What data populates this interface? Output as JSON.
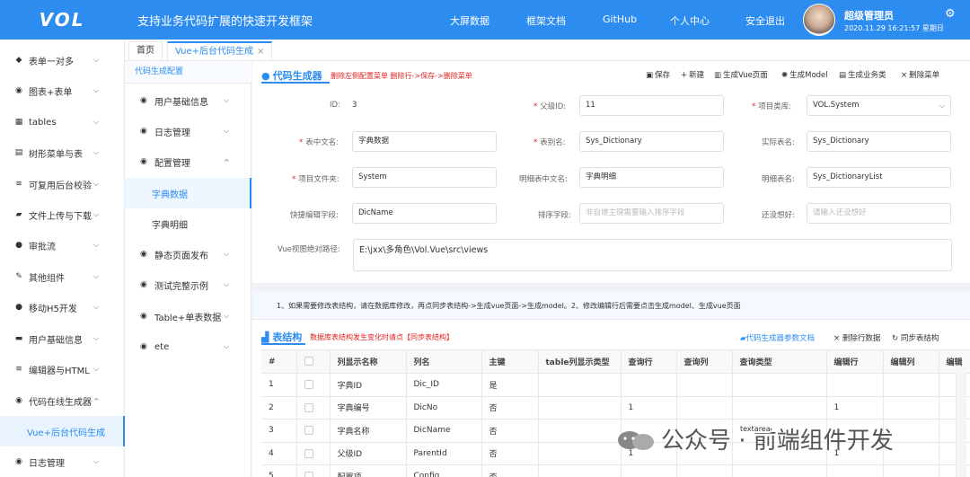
{
  "header": {
    "logo": "VOL",
    "slogan": "支持业务代码扩展的快速开发框架",
    "nav": [
      "大屏数据",
      "框架文档",
      "GitHub",
      "个人中心",
      "安全退出"
    ],
    "user_name": "超级管理员",
    "datetime": "2020.11.29 16:21:57 星期日",
    "brand_color": "#2d8cf0"
  },
  "sidebar": {
    "items": [
      {
        "label": "表单一对多",
        "icon": "cube-icon"
      },
      {
        "label": "图表+表单",
        "icon": "chart-icon"
      },
      {
        "label": "tables",
        "icon": "grid-icon"
      },
      {
        "label": "树形菜单与表",
        "icon": "tree-icon"
      },
      {
        "label": "可复用后台校验",
        "icon": "rss-icon"
      },
      {
        "label": "文件上传与下载",
        "icon": "folder-icon"
      },
      {
        "label": "审批流",
        "icon": "flow-icon"
      },
      {
        "label": "其他组件",
        "icon": "wrench-icon"
      },
      {
        "label": "移动H5开发",
        "icon": "apple-icon"
      },
      {
        "label": "用户基础信息",
        "icon": "user-icon"
      },
      {
        "label": "编辑器与HTML",
        "icon": "editor-icon"
      },
      {
        "label": "代码在线生成器",
        "icon": "code-icon"
      },
      {
        "label": "Vue+后台代码生成",
        "icon": ""
      },
      {
        "label": "日志管理",
        "icon": "log-icon"
      }
    ]
  },
  "tabs": {
    "home": "首页",
    "active": "Vue+后台代码生成",
    "close": "×"
  },
  "panel2": {
    "header": "代码生成配置",
    "items": [
      "用户基础信息",
      "日志管理",
      "配置管理",
      "字典数据",
      "字典明细",
      "静态页面发布",
      "测试完整示例",
      "Table+单表数据",
      "ete"
    ]
  },
  "form": {
    "title": "代码生成器",
    "hint": "删除左侧配置菜单 删除行->保存->删除菜单",
    "toolbar": [
      "保存",
      "新建",
      "生成Vue页面",
      "生成Model",
      "生成业务类",
      "删除菜单"
    ],
    "fields": {
      "id_label": "ID:",
      "id_value": "3",
      "parent_label": "父级ID:",
      "parent_value": "11",
      "ns_label": "项目类库:",
      "ns_value": "VOL.System",
      "cn_label": "表中文名:",
      "cn_value": "字典数据",
      "alias_label": "表别名:",
      "alias_value": "Sys_Dictionary",
      "real_label": "实际表名:",
      "real_value": "Sys_Dictionary",
      "folder_label": "项目文件夹:",
      "folder_value": "System",
      "detail_cn_label": "明细表中文名:",
      "detail_cn_value": "字典明细",
      "detail_label": "明细表名:",
      "detail_value": "Sys_DictionaryList",
      "quick_label": "快捷编辑字段:",
      "quick_value": "DicName",
      "sort_label": "排序字段:",
      "sort_placeholder": "非自增主键需要输入排序字段",
      "hobby_label": "还没想好:",
      "hobby_placeholder": "请输入还没想好",
      "path_label": "Vue视图绝对路径:",
      "path_value": "E:\\jxx\\多角色\\Vol.Vue\\src\\views"
    },
    "notice": "1、如果需要修改表结构，请在数据库修改，再点同步表结构->生成vue页面->生成model。2、修改编辑行后需要点击生成model、生成vue页面"
  },
  "table_structure": {
    "title": "表结构",
    "hint": "数据库表结构发生变化时请点【同步表结构】",
    "buttons": [
      "代码生成器参数文档",
      "删除行数据",
      "同步表结构"
    ],
    "columns": [
      "#",
      "",
      "列显示名称",
      "列名",
      "主键",
      "table列显示类型",
      "查询行",
      "查询列",
      "查询类型",
      "编辑行",
      "编辑列",
      "编辑"
    ],
    "rows": [
      [
        "1",
        "",
        "字典ID",
        "Dic_ID",
        "是",
        "",
        "",
        "",
        "",
        "",
        "",
        ""
      ],
      [
        "2",
        "",
        "字典编号",
        "DicNo",
        "否",
        "",
        "1",
        "",
        "",
        "1",
        "",
        ""
      ],
      [
        "3",
        "",
        "字典名称",
        "DicName",
        "否",
        "",
        "",
        "",
        "",
        "",
        "",
        ""
      ],
      [
        "4",
        "",
        "父级ID",
        "ParentId",
        "否",
        "",
        "1",
        "",
        "",
        "1",
        "",
        ""
      ],
      [
        "5",
        "",
        "配置项",
        "Config",
        "否",
        "",
        "",
        "",
        "",
        "",
        "",
        ""
      ]
    ]
  },
  "watermark": {
    "text": "公众号 · 前端组件开发",
    "tag": "textarea"
  }
}
